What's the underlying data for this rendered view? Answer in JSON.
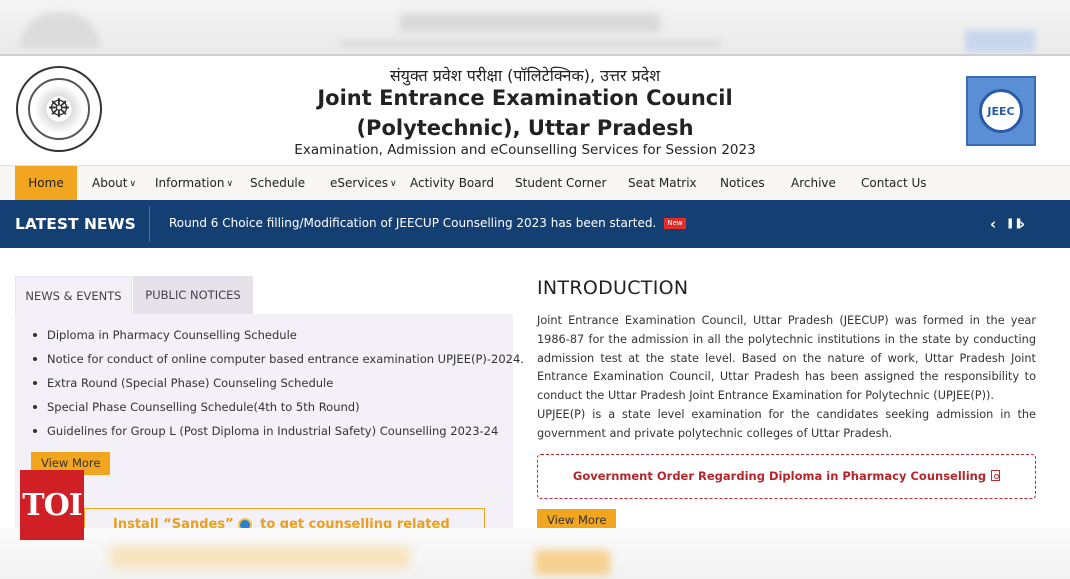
{
  "header": {
    "hindi_title": "संयुक्त प्रवेश परीक्षा (पॉलिटेक्निक), उत्तर प्रदेश",
    "title_line1": "Joint Entrance Examination Council",
    "title_line2": "(Polytechnic), Uttar Pradesh",
    "subtitle": "Examination, Admission and eCounselling Services for Session 2023",
    "left_logo_icon": "up-government-seal-icon",
    "right_logo_text": "JEEC"
  },
  "nav": {
    "items": [
      {
        "label": "Home",
        "active": true
      },
      {
        "label": "About",
        "dropdown": true
      },
      {
        "label": "Information",
        "dropdown": true
      },
      {
        "label": "Schedule"
      },
      {
        "label": "eServices",
        "dropdown": true
      },
      {
        "label": "Activity Board"
      },
      {
        "label": "Student Corner"
      },
      {
        "label": "Seat Matrix"
      },
      {
        "label": "Notices"
      },
      {
        "label": "Archive"
      },
      {
        "label": "Contact Us"
      }
    ]
  },
  "latest_news": {
    "label": "LATEST NEWS",
    "text": "Round 6 Choice filling/Modification of JEECUP Counselling 2023 has been started.",
    "badge": "New",
    "controls": {
      "prev": "‹",
      "pause": "❚❚",
      "next": "›"
    }
  },
  "tabs": {
    "news_events": "NEWS & EVENTS",
    "public_notices": "PUBLIC NOTICES"
  },
  "news_list": [
    "Diploma in Pharmacy Counselling Schedule",
    "Notice for conduct of online computer based entrance examination UPJEE(P)-2024.",
    "Extra Round (Special Phase) Counseling Schedule",
    "Special Phase Counselling Schedule(4th to 5th Round)",
    "Guidelines for Group L (Post Diploma in Industrial Safety) Counselling 2023-24"
  ],
  "left_view_more": "View More",
  "sandes": {
    "prefix": "Install ",
    "app": "“Sandes”",
    "suffix": " to get counselling related"
  },
  "intro": {
    "title": "INTRODUCTION",
    "para1": "Joint Entrance Examination Council, Uttar Pradesh (JEECUP) was formed in the year 1986-87 for the admission in all the polytechnic institutions in the state by conducting admission test at the state level. Based on the nature of work, Uttar Pradesh Joint Entrance Examination Council, Uttar Pradesh has been assigned the responsibility to conduct the Uttar Pradesh Joint Entrance Examination for Polytechnic (UPJEE(P)).",
    "para2": "UPJEE(P) is a state level examination for the candidates seeking admission in the government and private polytechnic colleges of Uttar Pradesh.",
    "order_link": "Government Order Regarding Diploma in Pharmacy Counselling",
    "view_more": "View More"
  },
  "watermark": "TOI",
  "colors": {
    "accent": "#f2a51f",
    "news_bar": "#143f73",
    "order_red": "#b2262c",
    "toi_red": "#d11f26"
  }
}
